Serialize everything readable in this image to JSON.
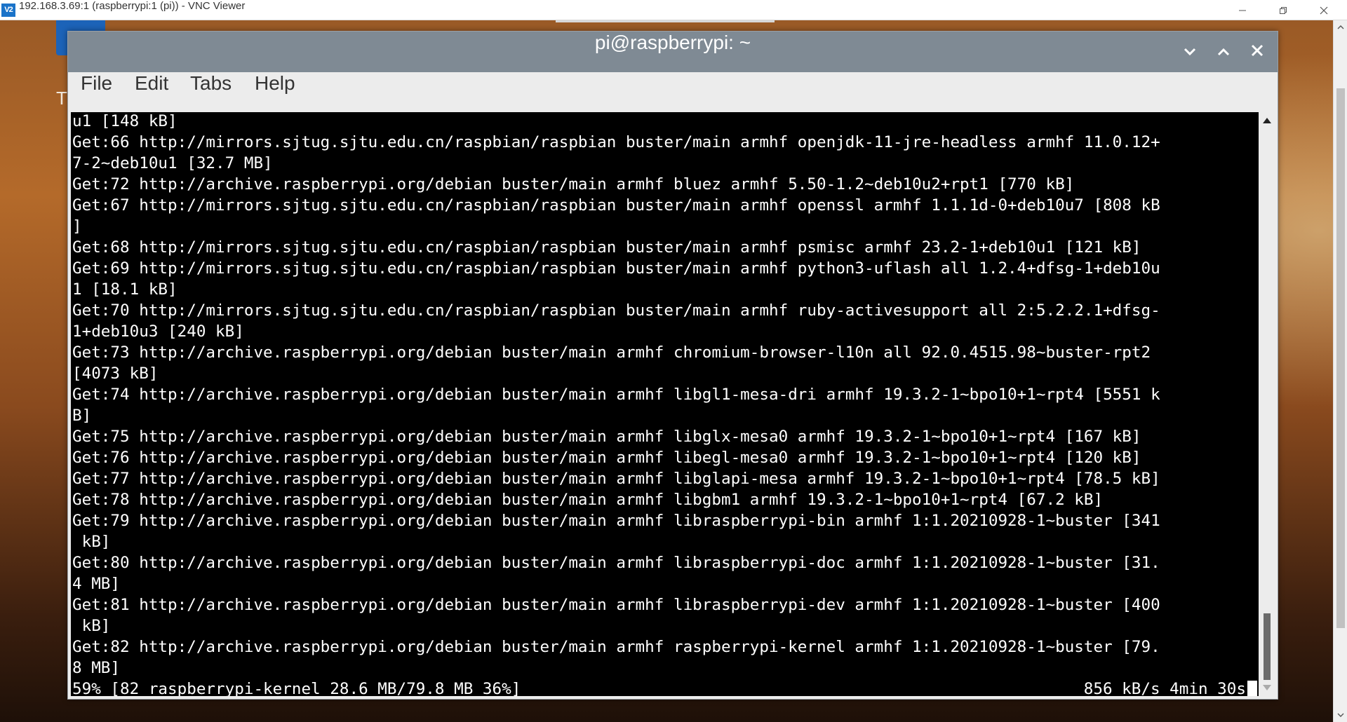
{
  "vnc": {
    "logo_text": "V2",
    "title": "192.168.3.69:1 (raspberrypi:1 (pi)) - VNC Viewer"
  },
  "desktop": {
    "partial_label": "T"
  },
  "terminal": {
    "title": "pi@raspberrypi: ~",
    "menu": [
      "File",
      "Edit",
      "Tabs",
      "Help"
    ],
    "lines": [
      "u1 [148 kB]",
      "Get:66 http://mirrors.sjtug.sjtu.edu.cn/raspbian/raspbian buster/main armhf openjdk-11-jre-headless armhf 11.0.12+",
      "7-2~deb10u1 [32.7 MB]",
      "Get:72 http://archive.raspberrypi.org/debian buster/main armhf bluez armhf 5.50-1.2~deb10u2+rpt1 [770 kB]",
      "Get:67 http://mirrors.sjtug.sjtu.edu.cn/raspbian/raspbian buster/main armhf openssl armhf 1.1.1d-0+deb10u7 [808 kB",
      "]",
      "Get:68 http://mirrors.sjtug.sjtu.edu.cn/raspbian/raspbian buster/main armhf psmisc armhf 23.2-1+deb10u1 [121 kB]",
      "Get:69 http://mirrors.sjtug.sjtu.edu.cn/raspbian/raspbian buster/main armhf python3-uflash all 1.2.4+dfsg-1+deb10u",
      "1 [18.1 kB]",
      "Get:70 http://mirrors.sjtug.sjtu.edu.cn/raspbian/raspbian buster/main armhf ruby-activesupport all 2:5.2.2.1+dfsg-",
      "1+deb10u3 [240 kB]",
      "Get:73 http://archive.raspberrypi.org/debian buster/main armhf chromium-browser-l10n all 92.0.4515.98~buster-rpt2",
      "[4073 kB]",
      "Get:74 http://archive.raspberrypi.org/debian buster/main armhf libgl1-mesa-dri armhf 19.3.2-1~bpo10+1~rpt4 [5551 k",
      "B]",
      "Get:75 http://archive.raspberrypi.org/debian buster/main armhf libglx-mesa0 armhf 19.3.2-1~bpo10+1~rpt4 [167 kB]",
      "Get:76 http://archive.raspberrypi.org/debian buster/main armhf libegl-mesa0 armhf 19.3.2-1~bpo10+1~rpt4 [120 kB]",
      "Get:77 http://archive.raspberrypi.org/debian buster/main armhf libglapi-mesa armhf 19.3.2-1~bpo10+1~rpt4 [78.5 kB]",
      "Get:78 http://archive.raspberrypi.org/debian buster/main armhf libgbm1 armhf 19.3.2-1~bpo10+1~rpt4 [67.2 kB]",
      "Get:79 http://archive.raspberrypi.org/debian buster/main armhf libraspberrypi-bin armhf 1:1.20210928-1~buster [341",
      " kB]",
      "Get:80 http://archive.raspberrypi.org/debian buster/main armhf libraspberrypi-doc armhf 1:1.20210928-1~buster [31.",
      "4 MB]",
      "Get:81 http://archive.raspberrypi.org/debian buster/main armhf libraspberrypi-dev armhf 1:1.20210928-1~buster [400",
      " kB]",
      "Get:82 http://archive.raspberrypi.org/debian buster/main armhf raspberrypi-kernel armhf 1:1.20210928-1~buster [79.",
      "8 MB]"
    ],
    "status_left": "59% [82 raspberrypi-kernel 28.6 MB/79.8 MB 36%]",
    "status_right": "856 kB/s 4min 30s"
  },
  "icons": {
    "vnc_logo": "vnc-logo-icon",
    "minimize": "minimize-icon",
    "restore": "restore-icon",
    "close": "close-icon",
    "term_minimize": "chevron-down-icon",
    "term_maximize": "chevron-up-icon",
    "term_close": "close-icon"
  },
  "colors": {
    "terminal_bg": "#000000",
    "terminal_fg": "#ffffff",
    "titlebar": "#7f8a94",
    "vnc_logo": "#1a73c9"
  }
}
